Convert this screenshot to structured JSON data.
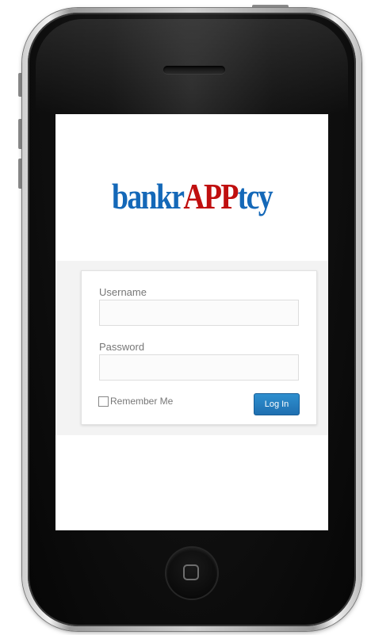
{
  "logo": {
    "part1": "bankr",
    "part2": "APP",
    "part3": "tcy",
    "color_primary": "#1468b8",
    "color_accent": "#c00f0f"
  },
  "login": {
    "username_label": "Username",
    "username_value": "",
    "password_label": "Password",
    "password_value": "",
    "remember_label": "Remember Me",
    "remember_checked": false,
    "submit_label": "Log In",
    "submit_color": "#2078c0"
  },
  "device": {
    "home_button_icon": "rounded-square-icon",
    "speaker": "speaker-grille"
  }
}
